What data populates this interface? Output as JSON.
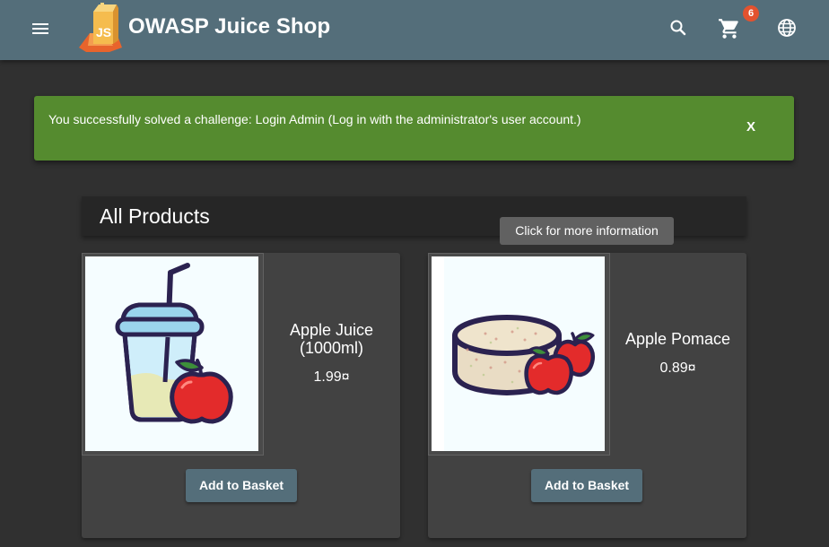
{
  "header": {
    "title": "OWASP Juice Shop",
    "logo_text": "JS",
    "menu_icon": "menu-icon",
    "search_icon": "search-icon",
    "cart_icon": "shopping-cart-icon",
    "cart_count": "6",
    "language_icon": "globe-icon"
  },
  "notification": {
    "message": "You successfully solved a challenge: Login Admin (Log in with the administrator's user account.)",
    "close_label": "X"
  },
  "section": {
    "title": "All Products"
  },
  "tooltip": "Click for more information",
  "products": [
    {
      "name": "Apple Juice (1000ml)",
      "price": "1.99¤",
      "button_label": "Add to Basket",
      "image_icon": "apple-juice-icon"
    },
    {
      "name": "Apple Pomace",
      "price": "0.89¤",
      "button_label": "Add to Basket",
      "image_icon": "apple-pomace-icon"
    }
  ],
  "colors": {
    "toolbar": "#546e7a",
    "background": "#303030",
    "card": "#424242",
    "notification": "#558b2f",
    "badge": "#e2522f"
  }
}
